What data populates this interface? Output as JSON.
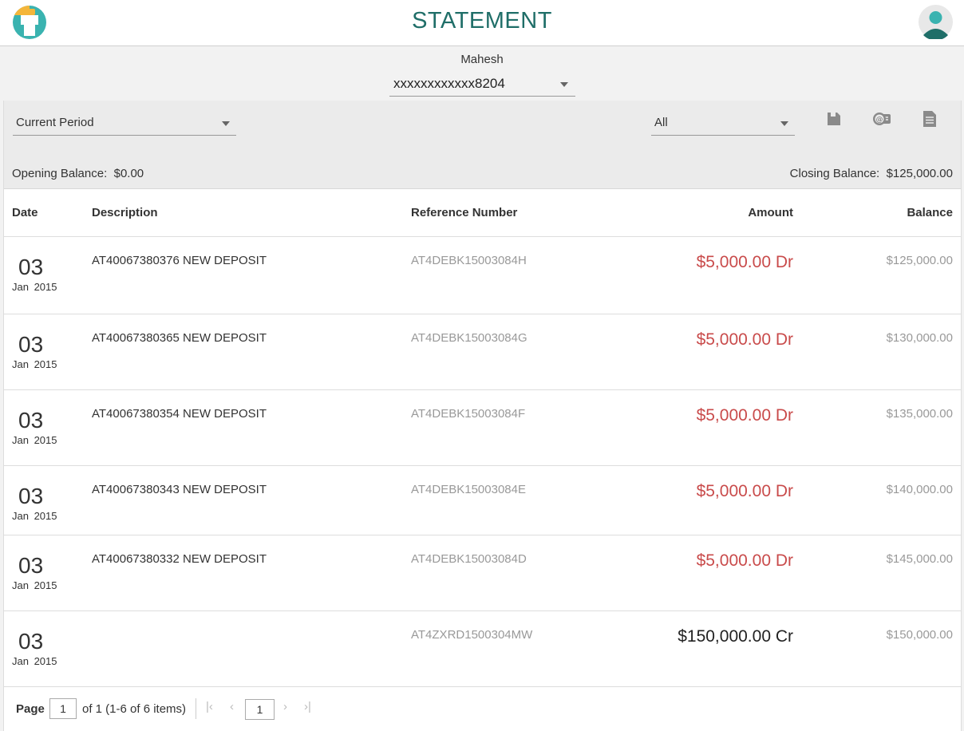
{
  "header": {
    "title": "STATEMENT"
  },
  "account": {
    "holder": "Mahesh",
    "selected": "xxxxxxxxxxxx8204"
  },
  "filters": {
    "period": "Current Period",
    "type": "All"
  },
  "balances": {
    "opening_label": "Opening Balance:",
    "opening_value": "$0.00",
    "closing_label": "Closing Balance:",
    "closing_value": "$125,000.00"
  },
  "table": {
    "headers": {
      "date": "Date",
      "description": "Description",
      "reference": "Reference Number",
      "amount": "Amount",
      "balance": "Balance"
    },
    "rows": [
      {
        "day": "03",
        "month_year": "Jan 2015",
        "description": "AT40067380376 NEW DEPOSIT",
        "reference": "AT4DEBK15003084H",
        "amount": "$5,000.00 Dr",
        "balance": "$125,000.00"
      },
      {
        "day": "03",
        "month_year": "Jan 2015",
        "description": "AT40067380365 NEW DEPOSIT",
        "reference": "AT4DEBK15003084G",
        "amount": "$5,000.00 Dr",
        "balance": "$130,000.00"
      },
      {
        "day": "03",
        "month_year": "Jan 2015",
        "description": "AT40067380354 NEW DEPOSIT",
        "reference": "AT4DEBK15003084F",
        "amount": "$5,000.00 Dr",
        "balance": "$135,000.00"
      },
      {
        "day": "03",
        "month_year": "Jan 2015",
        "description": "AT40067380343 NEW DEPOSIT",
        "reference": "AT4DEBK15003084E",
        "amount": "$5,000.00 Dr",
        "balance": "$140,000.00"
      },
      {
        "day": "03",
        "month_year": "Jan 2015",
        "description": "AT40067380332 NEW DEPOSIT",
        "reference": "AT4DEBK15003084D",
        "amount": "$5,000.00 Dr",
        "balance": "$145,000.00"
      },
      {
        "day": "03",
        "month_year": "Jan 2015",
        "description": "",
        "reference": "AT4ZXRD1500304MW",
        "amount": "$150,000.00 Cr",
        "balance": "$150,000.00"
      }
    ]
  },
  "pager": {
    "label": "Page",
    "page_input": "1",
    "summary": "of 1 (1-6 of 6 items)",
    "current": "1"
  },
  "colors": {
    "brand": "#1f6e68",
    "debit": "#c94b4b"
  },
  "icons": [
    "app-logo-icon",
    "user-avatar-icon",
    "save-icon",
    "email-icon",
    "document-icon",
    "first-page-icon",
    "prev-page-icon",
    "next-page-icon",
    "last-page-icon"
  ]
}
